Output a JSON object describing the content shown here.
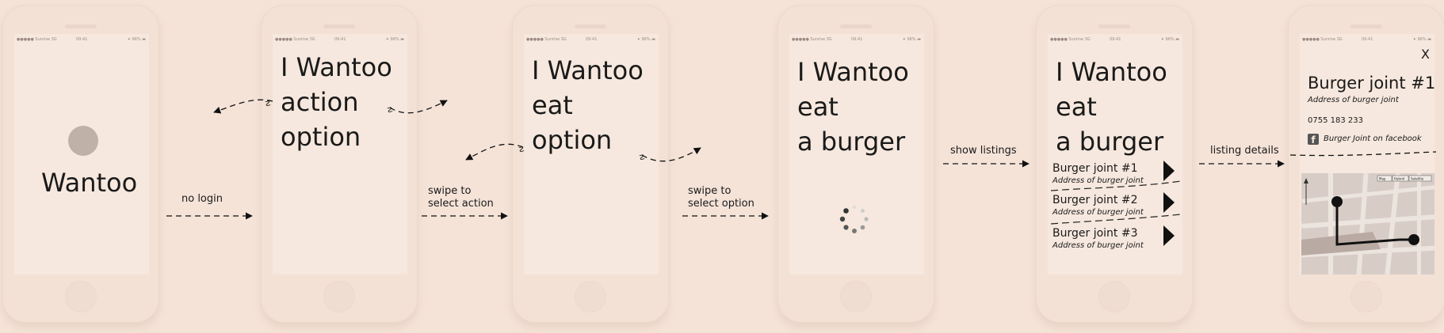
{
  "status_bar": {
    "carrier": "●●●●● Sunrise  3G",
    "time": "09:41",
    "battery": "✦ 96% ▬"
  },
  "screen1": {
    "title": "Wantoo"
  },
  "screen2": {
    "line1": "I Wantoo",
    "line2": "action",
    "line3": "option"
  },
  "screen3": {
    "line1": "I Wantoo",
    "line2": "eat",
    "line3": "option"
  },
  "screen4": {
    "line1": "I Wantoo",
    "line2": "eat",
    "line3": "a burger"
  },
  "screen5": {
    "line1": "I Wantoo",
    "line2": "eat",
    "line3": "a burger",
    "listings": [
      {
        "name": "Burger joint #1",
        "address": "Address of burger joint"
      },
      {
        "name": "Burger joint #2",
        "address": "Address of burger joint"
      },
      {
        "name": "Burger joint #3",
        "address": "Address of burger joint"
      }
    ]
  },
  "screen6": {
    "close": "X",
    "title": "Burger joint #1",
    "address": "Address of burger joint",
    "phone": "0755 183 233",
    "facebook": "Burger Joint on facebook",
    "map_buttons": [
      "Map",
      "Hybrid",
      "Satellite"
    ]
  },
  "transitions": {
    "t1": "no login",
    "t2_line1": "swipe to",
    "t2_line2": "select action",
    "t3_line1": "swipe to",
    "t3_line2": "select option",
    "t4": "show listings",
    "t5": "listing details"
  },
  "colors": {
    "background": "#f5e3d8",
    "screen": "#f6e8de",
    "ink": "#1a1a1a",
    "logo_circle": "#bfb0a8"
  }
}
